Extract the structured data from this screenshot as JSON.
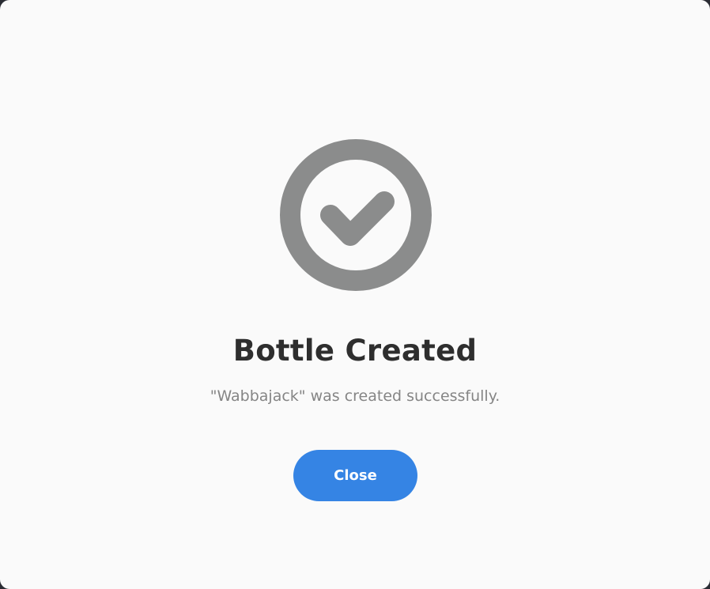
{
  "dialog": {
    "status_icon": "checkmark-circle-icon",
    "icon_color": "#8b8c8c",
    "title": "Bottle Created",
    "description": "\"Wabbajack\" was created successfully.",
    "close_label": "Close",
    "accent_color": "#3584e4"
  }
}
